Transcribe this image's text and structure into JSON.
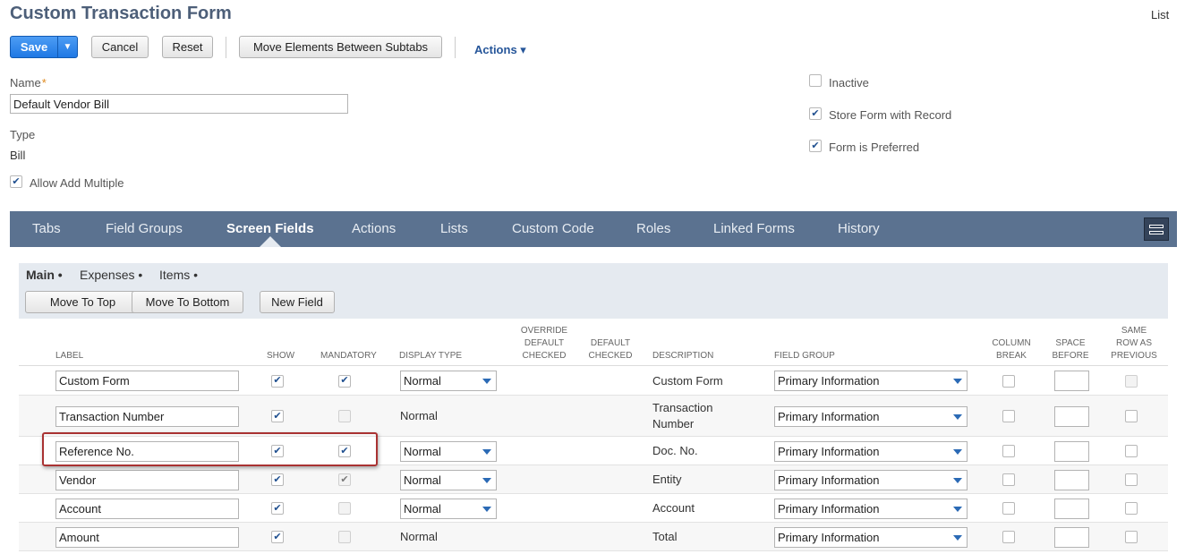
{
  "page": {
    "title": "Custom Transaction Form",
    "list_link": "List"
  },
  "toolbar": {
    "save": "Save",
    "save_arrow": "▼",
    "cancel": "Cancel",
    "reset": "Reset",
    "move_elements": "Move Elements Between Subtabs",
    "actions": "Actions ▾"
  },
  "form": {
    "name_label": "Name",
    "required_mark": "*",
    "name_value": "Default Vendor Bill",
    "type_label": "Type",
    "type_value": "Bill",
    "allow_add_multiple": {
      "label": "Allow Add Multiple",
      "checked": true
    },
    "inactive": {
      "label": "Inactive",
      "checked": false
    },
    "store_form_with_record": {
      "label": "Store Form with Record",
      "checked": true
    },
    "form_is_preferred": {
      "label": "Form is Preferred",
      "checked": true
    }
  },
  "tabs": [
    {
      "label": "Tabs",
      "active": false
    },
    {
      "label": "Field Groups",
      "active": false
    },
    {
      "label": "Screen Fields",
      "active": true
    },
    {
      "label": "Actions",
      "active": false
    },
    {
      "label": "Lists",
      "active": false
    },
    {
      "label": "Custom Code",
      "active": false
    },
    {
      "label": "Roles",
      "active": false
    },
    {
      "label": "Linked Forms",
      "active": false
    },
    {
      "label": "History",
      "active": false
    }
  ],
  "subtabs": [
    {
      "label": "Main •",
      "active": true
    },
    {
      "label": "Expenses •",
      "active": false
    },
    {
      "label": "Items •",
      "active": false
    }
  ],
  "grid_buttons": {
    "move_to_top": "Move To Top",
    "move_to_bottom": "Move To Bottom",
    "new_field": "New Field"
  },
  "columns": {
    "label": "Label",
    "show": "Show",
    "mandatory": "Mandatory",
    "display_type": "Display Type",
    "override_1": "Override",
    "override_2": "Default",
    "override_3": "Checked",
    "default_checked_1": "Default",
    "default_checked_2": "Checked",
    "description": "Description",
    "field_group": "Field Group",
    "column_break_1": "Column",
    "column_break_2": "Break",
    "space_before_1": "Space",
    "space_before_2": "Before",
    "same_row_1": "Same",
    "same_row_2": "Row As",
    "same_row_3": "Previous"
  },
  "rows": [
    {
      "label": "Custom Form",
      "show": true,
      "mandatory": true,
      "mandatory_enabled": true,
      "display_type": "Normal",
      "display_is_select": true,
      "description": "Custom Form",
      "description_2": "",
      "field_group": "Primary Information"
    },
    {
      "label": "Transaction Number",
      "show": true,
      "mandatory": false,
      "mandatory_enabled": false,
      "display_type": "Normal",
      "display_is_select": false,
      "description": "Transaction",
      "description_2": "Number",
      "field_group": "Primary Information"
    },
    {
      "label": "Reference No.",
      "show": true,
      "mandatory": true,
      "mandatory_enabled": true,
      "display_type": "Normal",
      "display_is_select": true,
      "description": "Doc. No.",
      "description_2": "",
      "field_group": "Primary Information"
    },
    {
      "label": "Vendor",
      "show": true,
      "mandatory": true,
      "mandatory_enabled": false,
      "display_type": "Normal",
      "display_is_select": true,
      "description": "Entity",
      "description_2": "",
      "field_group": "Primary Information"
    },
    {
      "label": "Account",
      "show": true,
      "mandatory": false,
      "mandatory_enabled": false,
      "display_type": "Normal",
      "display_is_select": true,
      "description": "Account",
      "description_2": "",
      "field_group": "Primary Information"
    },
    {
      "label": "Amount",
      "show": true,
      "mandatory": false,
      "mandatory_enabled": false,
      "display_type": "Normal",
      "display_is_select": false,
      "description": "Total",
      "description_2": "",
      "field_group": "Primary Information"
    }
  ],
  "icons": {
    "check": "✔",
    "layout_toggle": "layout-icon"
  },
  "colors": {
    "accent": "#1f78e4",
    "tabbar": "#5b7290",
    "title": "#4d5f79",
    "highlight": "#a93232"
  }
}
